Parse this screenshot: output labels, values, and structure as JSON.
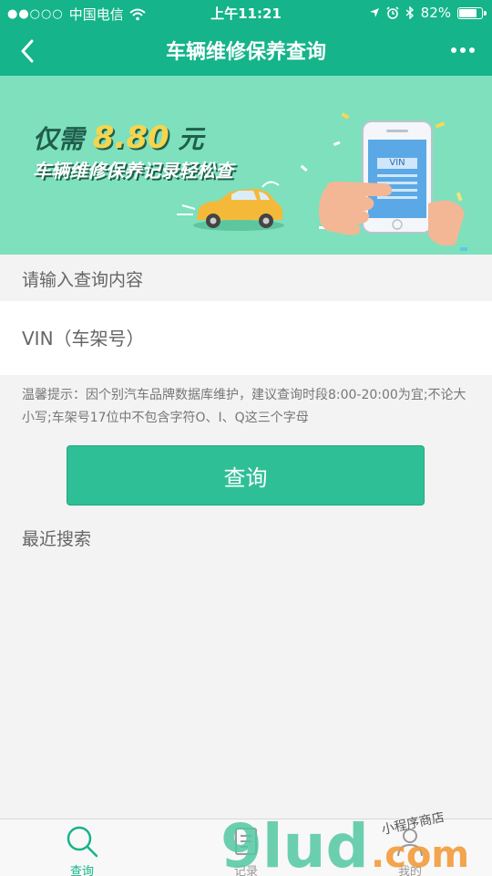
{
  "status": {
    "carrier": "中国电信",
    "time": "上午11:21",
    "battery": "82%",
    "battery_level": 0.82
  },
  "nav": {
    "title": "车辆维修保养查询"
  },
  "banner": {
    "prefix": "仅需",
    "price": "8.80",
    "suffix": "元",
    "subtitle": "车辆维修保养记录轻松查",
    "phone_text": "VIN"
  },
  "form": {
    "label": "请输入查询内容",
    "vin_placeholder": "VIN（车架号）",
    "vin_value": "",
    "tip": "温馨提示：因个别汽车品牌数据库维护，建议查询时段8:00-20:00为宜;不论大小写;车架号17位中不包含字符O、I、Q这三个字母",
    "query_button": "查询",
    "recent_label": "最近搜索"
  },
  "tabbar": {
    "tabs": [
      {
        "label": "查询",
        "icon": "search-icon",
        "active": true
      },
      {
        "label": "记录",
        "icon": "record-icon",
        "active": false
      },
      {
        "label": "我的",
        "icon": "user-icon",
        "active": false
      }
    ]
  },
  "watermark": {
    "brand": "9lud",
    "domain": ".com",
    "slogan": "小程序商店"
  },
  "colors": {
    "primary": "#15b48a",
    "button": "#2fbf96",
    "banner_bg": "#7ee0bd"
  }
}
